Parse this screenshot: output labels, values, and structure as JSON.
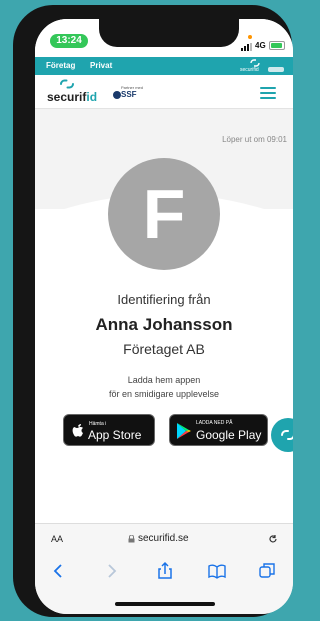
{
  "status_bar": {
    "time": "13:24",
    "network": "4G"
  },
  "top_bar": {
    "tabs": [
      "Företag",
      "Privat"
    ],
    "mini_logo": "securifid"
  },
  "header": {
    "logo_prefix": "securif",
    "logo_suffix": "id",
    "partner_top": "Partner med",
    "partner_name": "SSF"
  },
  "session": {
    "expires": "Löper ut om 09:01"
  },
  "identity": {
    "avatar_letter": "F",
    "heading": "Identifiering från",
    "name": "Anna Johansson",
    "company": "Företaget AB",
    "download_line1": "Ladda hem appen",
    "download_line2": "för en smidigare upplevelse"
  },
  "stores": {
    "app_store": {
      "small": "Hämta i",
      "big": "App Store"
    },
    "google_play": {
      "small": "LADDA NED PÅ",
      "big": "Google Play"
    }
  },
  "browser": {
    "text_size": "AA",
    "url": "securifid.se"
  },
  "colors": {
    "accent": "#1fa4ae",
    "avatar": "#a6a6a6",
    "status_green": "#34c759"
  }
}
